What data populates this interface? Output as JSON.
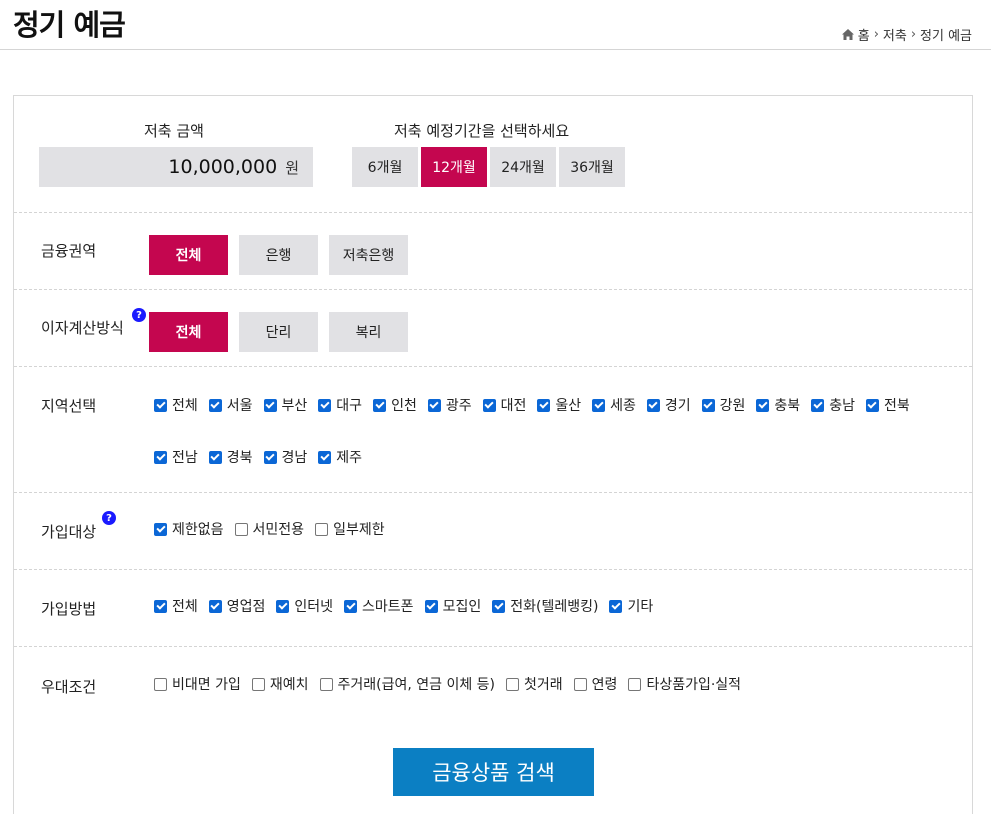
{
  "header": {
    "title": "정기 예금",
    "breadcrumb": [
      "홈",
      "저축",
      "정기 예금"
    ]
  },
  "amount": {
    "label": "저축 금액",
    "value": "10,000,000",
    "unit": "원"
  },
  "period": {
    "label": "저축 예정기간을 선택하세요",
    "options": [
      "6개월",
      "12개월",
      "24개월",
      "36개월"
    ],
    "selected": "12개월"
  },
  "sector": {
    "label": "금융권역",
    "options": [
      "전체",
      "은행",
      "저축은행"
    ],
    "selected": "전체"
  },
  "interest": {
    "label": "이자계산방식",
    "help": "?",
    "options": [
      "전체",
      "단리",
      "복리"
    ],
    "selected": "전체"
  },
  "region": {
    "label": "지역선택",
    "items": [
      {
        "label": "전체",
        "checked": true
      },
      {
        "label": "서울",
        "checked": true
      },
      {
        "label": "부산",
        "checked": true
      },
      {
        "label": "대구",
        "checked": true
      },
      {
        "label": "인천",
        "checked": true
      },
      {
        "label": "광주",
        "checked": true
      },
      {
        "label": "대전",
        "checked": true
      },
      {
        "label": "울산",
        "checked": true
      },
      {
        "label": "세종",
        "checked": true
      },
      {
        "label": "경기",
        "checked": true
      },
      {
        "label": "강원",
        "checked": true
      },
      {
        "label": "충북",
        "checked": true
      },
      {
        "label": "충남",
        "checked": true
      },
      {
        "label": "전북",
        "checked": true
      },
      {
        "label": "전남",
        "checked": true
      },
      {
        "label": "경북",
        "checked": true
      },
      {
        "label": "경남",
        "checked": true
      },
      {
        "label": "제주",
        "checked": true
      }
    ]
  },
  "target": {
    "label": "가입대상",
    "help": "?",
    "items": [
      {
        "label": "제한없음",
        "checked": true
      },
      {
        "label": "서민전용",
        "checked": false
      },
      {
        "label": "일부제한",
        "checked": false
      }
    ]
  },
  "method": {
    "label": "가입방법",
    "items": [
      {
        "label": "전체",
        "checked": true
      },
      {
        "label": "영업점",
        "checked": true
      },
      {
        "label": "인터넷",
        "checked": true
      },
      {
        "label": "스마트폰",
        "checked": true
      },
      {
        "label": "모집인",
        "checked": true
      },
      {
        "label": "전화(텔레뱅킹)",
        "checked": true
      },
      {
        "label": "기타",
        "checked": true
      }
    ]
  },
  "preference": {
    "label": "우대조건",
    "items": [
      {
        "label": "비대면 가입",
        "checked": false
      },
      {
        "label": "재예치",
        "checked": false
      },
      {
        "label": "주거래(급여, 연금 이체 등)",
        "checked": false
      },
      {
        "label": "첫거래",
        "checked": false
      },
      {
        "label": "연령",
        "checked": false
      },
      {
        "label": "타상품가입·실적",
        "checked": false
      }
    ]
  },
  "search_label": "금융상품 검색"
}
